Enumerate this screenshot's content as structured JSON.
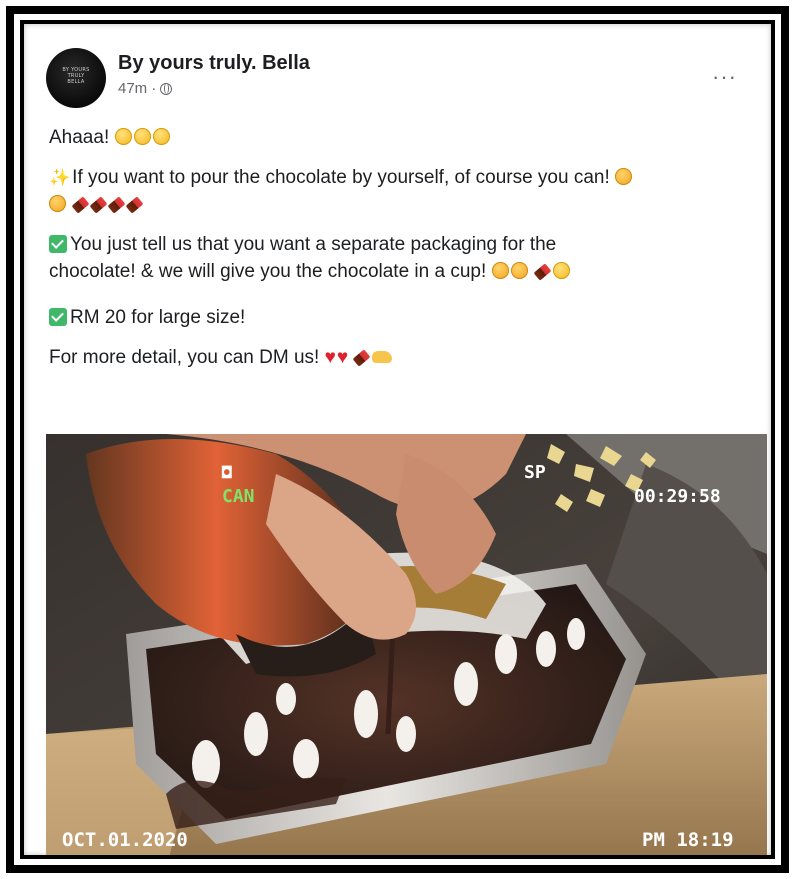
{
  "post": {
    "author": "By yours truly. Bella",
    "time": "47m",
    "meta_separator": "·",
    "privacy_icon": "globe-icon",
    "more_label": "···",
    "avatar_text": "BY YOURS TRULY BELLA",
    "lines": {
      "l1": "Ahaaa!",
      "l2": "If you want to pour the chocolate by yourself, of course you can!",
      "l3a": "You just tell us that you want a separate packaging for the",
      "l3b": "chocolate! & we will give you the chocolate in a cup!",
      "l4": "RM 20 for large size!",
      "l5": "For more detail, you can DM us!"
    },
    "emojis": {
      "l1": [
        "smile-emoji",
        "smile-emoji",
        "smile-emoji"
      ],
      "l2_lead": "sparkles-emoji",
      "l2_tail": [
        "wink-emoji",
        "wink-emoji",
        "chocolate-emoji",
        "chocolate-emoji",
        "chocolate-emoji",
        "chocolate-emoji"
      ],
      "l3_lead": "check-box-emoji",
      "l3_tail": [
        "wink-emoji",
        "wink-emoji",
        "chocolate-emoji",
        "smile-emoji"
      ],
      "l4_lead": "check-box-emoji",
      "l5_tail": [
        "heart-emoji",
        "heart-emoji",
        "chocolate-emoji",
        "hand-emoji"
      ]
    },
    "photo": {
      "overlay_mode": "CAN",
      "overlay_sp": "SP",
      "overlay_timer": "00:29:58",
      "overlay_date": "OCT.01.2020",
      "overlay_time": "PM 18:19",
      "colors": {
        "table": "#b08a5a",
        "chocolate": "#3a1c12",
        "foil": "#d9d6d2",
        "bottle": "#e0592a"
      }
    }
  }
}
